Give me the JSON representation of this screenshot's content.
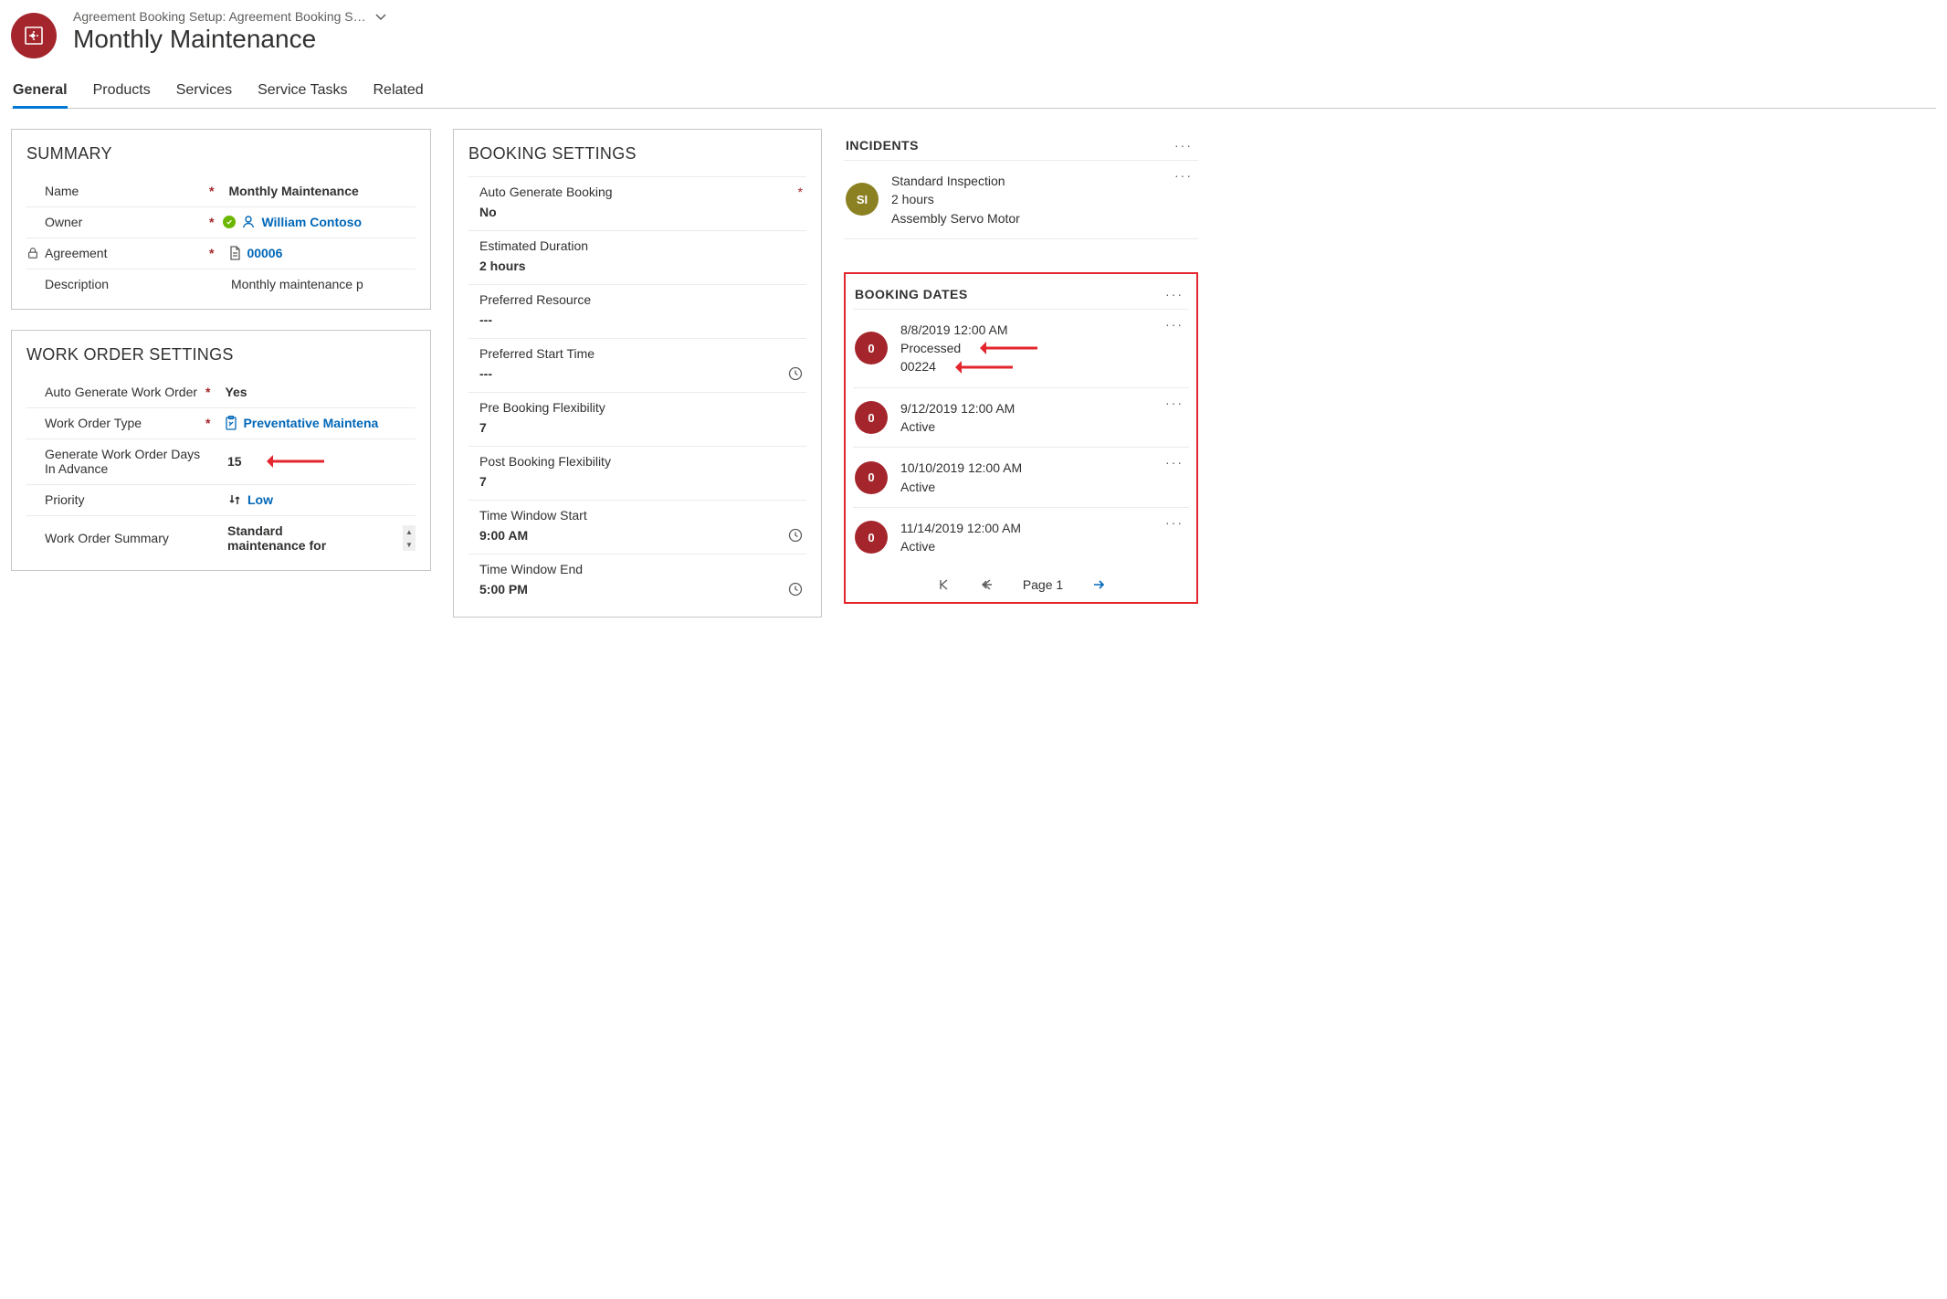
{
  "header": {
    "breadcrumb": "Agreement Booking Setup: Agreement Booking S…",
    "title": "Monthly Maintenance"
  },
  "tabs": [
    "General",
    "Products",
    "Services",
    "Service Tasks",
    "Related"
  ],
  "summary": {
    "title": "SUMMARY",
    "name_label": "Name",
    "name_value": "Monthly Maintenance",
    "owner_label": "Owner",
    "owner_value": "William Contoso",
    "agreement_label": "Agreement",
    "agreement_value": "00006",
    "description_label": "Description",
    "description_value": "Monthly maintenance p"
  },
  "work_order": {
    "title": "WORK ORDER SETTINGS",
    "auto_gen_label": "Auto Generate Work Order",
    "auto_gen_value": "Yes",
    "type_label": "Work Order Type",
    "type_value": "Preventative Maintena",
    "days_label": "Generate Work Order Days In Advance",
    "days_value": "15",
    "priority_label": "Priority",
    "priority_value": "Low",
    "summary_label": "Work Order Summary",
    "summary_value": "Standard maintenance for"
  },
  "booking": {
    "title": "BOOKING SETTINGS",
    "auto_gen_label": "Auto Generate Booking",
    "auto_gen_value": "No",
    "est_dur_label": "Estimated Duration",
    "est_dur_value": "2 hours",
    "pref_res_label": "Preferred Resource",
    "pref_res_value": "---",
    "pref_start_label": "Preferred Start Time",
    "pref_start_value": "---",
    "pre_flex_label": "Pre Booking Flexibility",
    "pre_flex_value": "7",
    "post_flex_label": "Post Booking Flexibility",
    "post_flex_value": "7",
    "win_start_label": "Time Window Start",
    "win_start_value": "9:00 AM",
    "win_end_label": "Time Window End",
    "win_end_value": "5:00 PM"
  },
  "incidents": {
    "title": "INCIDENTS",
    "item": {
      "avatar": "SI",
      "line1": "Standard Inspection",
      "line2": "2 hours",
      "line3": "Assembly Servo Motor"
    }
  },
  "booking_dates": {
    "title": "BOOKING DATES",
    "items": [
      {
        "avatar": "0",
        "line1": "8/8/2019 12:00 AM",
        "line2": "Processed",
        "line3": "00224"
      },
      {
        "avatar": "0",
        "line1": "9/12/2019 12:00 AM",
        "line2": "Active",
        "line3": ""
      },
      {
        "avatar": "0",
        "line1": "10/10/2019 12:00 AM",
        "line2": "Active",
        "line3": ""
      },
      {
        "avatar": "0",
        "line1": "11/14/2019 12:00 AM",
        "line2": "Active",
        "line3": ""
      }
    ],
    "page_label": "Page 1"
  }
}
